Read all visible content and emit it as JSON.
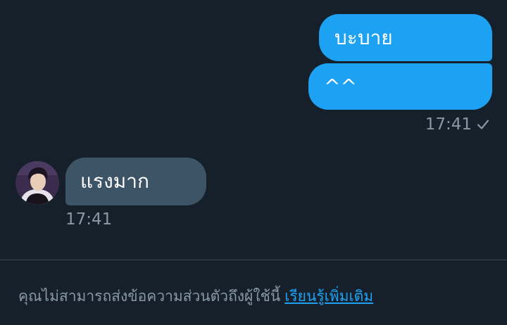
{
  "conversation": {
    "outgoing": {
      "messages": [
        "บะบาย",
        "^^"
      ],
      "time": "17:41",
      "status_icon": "check-icon"
    },
    "incoming": {
      "avatar_icon": "avatar",
      "messages": [
        "แรงมาก"
      ],
      "time": "17:41"
    }
  },
  "footer": {
    "notice": "คุณไม่สามารถส่งข้อความส่วนตัวถึงผู้ใช้นี้",
    "learn_more": "เรียนรู้เพิ่มเติม"
  },
  "colors": {
    "background": "#15202b",
    "outgoing_bubble": "#1da1f2",
    "incoming_bubble": "#3d5466",
    "muted_text": "#8899a6",
    "link": "#1da1f2"
  }
}
